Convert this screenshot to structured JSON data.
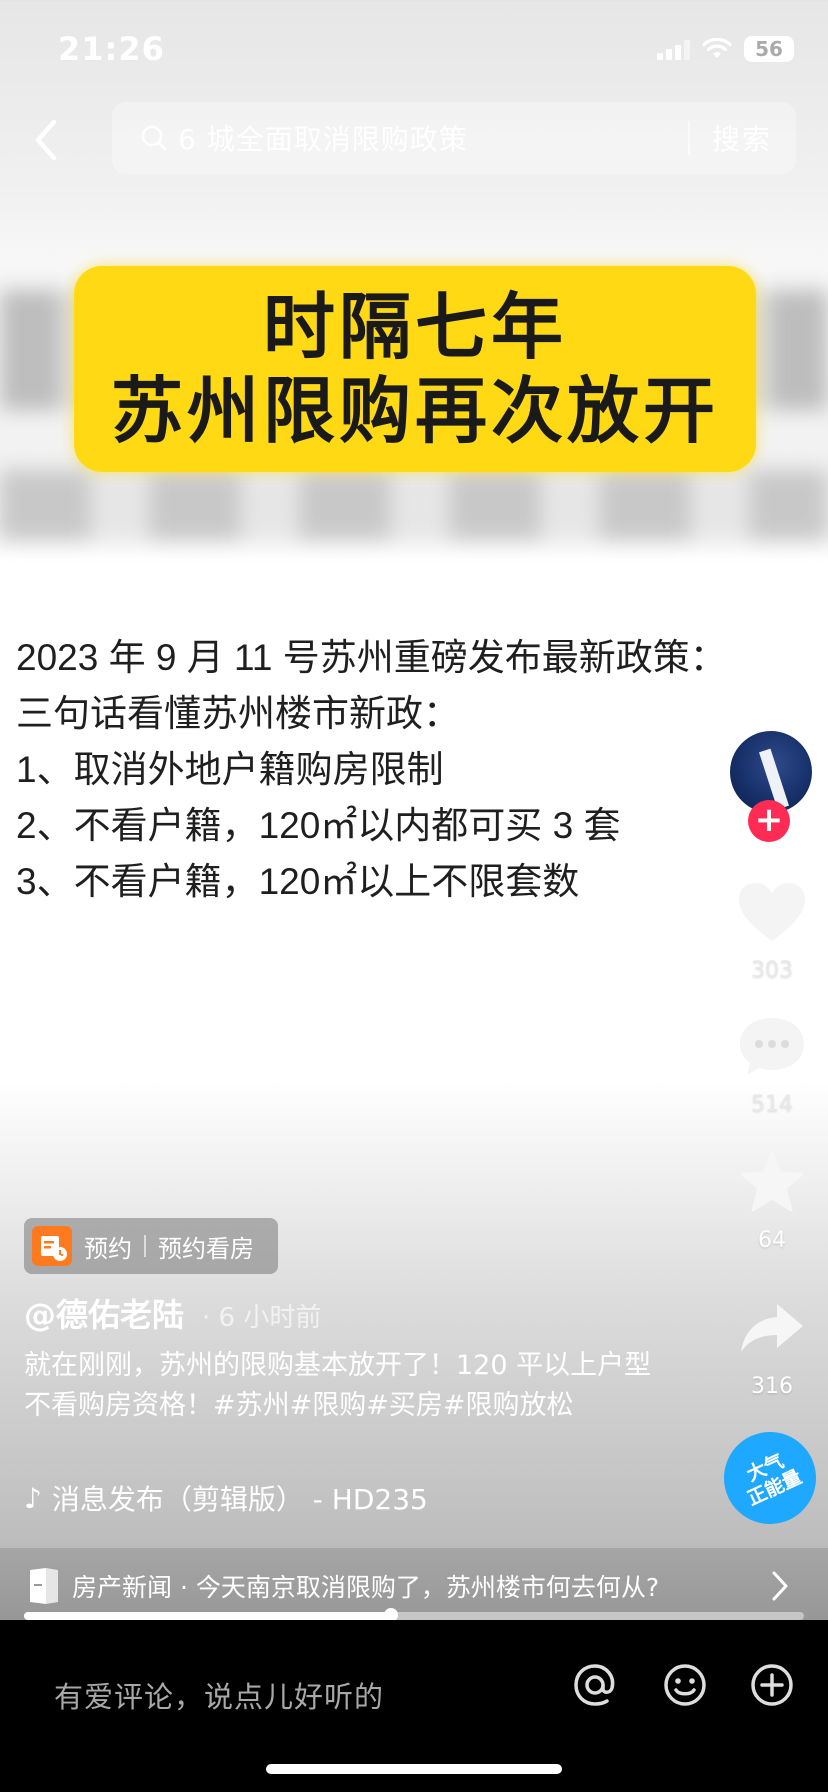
{
  "status_bar": {
    "time": "21:26",
    "battery": "56"
  },
  "search": {
    "query": "6 城全面取消限购政策",
    "button_label": "搜索"
  },
  "banner": {
    "line1": "时隔七年",
    "line2": "苏州限购再次放开"
  },
  "article": {
    "lines": [
      "2023 年 9 月 11 号苏州重磅发布最新政策：",
      "三句话看懂苏州楼市新政：",
      "1、取消外地户籍购房限制",
      "2、不看户籍，120㎡以内都可买 3 套",
      "3、不看户籍，120㎡以上不限套数"
    ]
  },
  "rail": {
    "likes": "303",
    "comments": "514",
    "favorites": "64",
    "shares": "316",
    "badge_line1": "大气",
    "badge_line2": "正能量"
  },
  "booking": {
    "label": "预约",
    "title": "预约看房"
  },
  "post": {
    "author": "@德佑老陆",
    "time": "· 6 小时前",
    "caption": "就在刚刚，苏州的限购基本放开了！120 平以上户型不看购房资格！#苏州#限购#买房#限购放松",
    "music": "消息发布（剪辑版） - HD235"
  },
  "related": {
    "text": "房产新闻 · 今天南京取消限购了，苏州楼市何去何从?"
  },
  "progress": {
    "fraction": 0.47
  },
  "comment_bar": {
    "placeholder": "有爱评论，说点儿好听的"
  },
  "icons": [
    "back-icon",
    "search-icon",
    "heart-icon",
    "comment-icon",
    "star-icon",
    "share-icon",
    "music-icon",
    "at-icon",
    "emoji-icon",
    "plus-icon",
    "chevron-right-icon"
  ],
  "colors": {
    "banner": "#ffd914",
    "follow": "#fe2c55",
    "badge": "#1fa8ff",
    "booking_icon": "#ff7a1f"
  }
}
